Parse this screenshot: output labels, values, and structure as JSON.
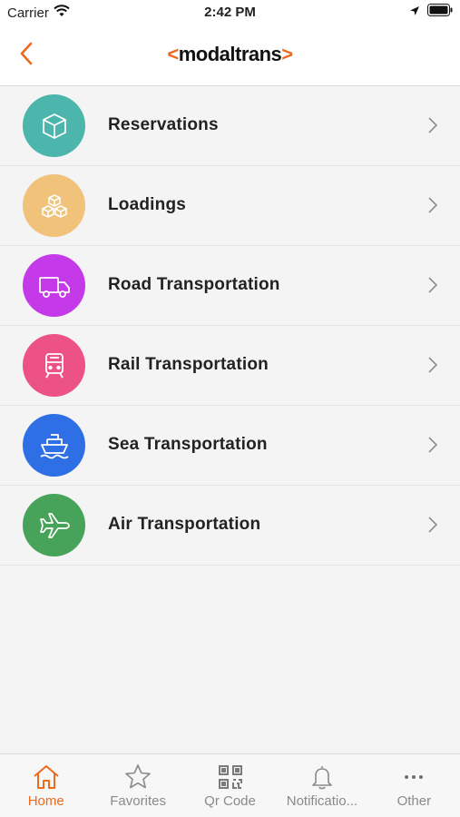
{
  "status_bar": {
    "carrier": "Carrier",
    "time": "2:42 PM"
  },
  "header": {
    "logo_prefix": "<",
    "logo_text": "modaltrans",
    "logo_suffix": ">",
    "accent_color": "#ee6a1f"
  },
  "menu": {
    "items": [
      {
        "label": "Reservations",
        "icon": "box-icon",
        "color": "#4db6ac"
      },
      {
        "label": "Loadings",
        "icon": "boxes-icon",
        "color": "#f0c27a"
      },
      {
        "label": "Road Transportation",
        "icon": "truck-icon",
        "color": "#c43ae8"
      },
      {
        "label": "Rail Transportation",
        "icon": "train-icon",
        "color": "#ec5285"
      },
      {
        "label": "Sea Transportation",
        "icon": "ship-icon",
        "color": "#2f6fe6"
      },
      {
        "label": "Air Transportation",
        "icon": "plane-icon",
        "color": "#48a35a"
      }
    ]
  },
  "tab_bar": {
    "tabs": [
      {
        "label": "Home",
        "icon": "home-icon",
        "active": true
      },
      {
        "label": "Favorites",
        "icon": "star-icon",
        "active": false
      },
      {
        "label": "Qr Code",
        "icon": "qr-code-icon",
        "active": false
      },
      {
        "label": "Notificatio...",
        "icon": "bell-icon",
        "active": false
      },
      {
        "label": "Other",
        "icon": "more-icon",
        "active": false
      }
    ]
  }
}
